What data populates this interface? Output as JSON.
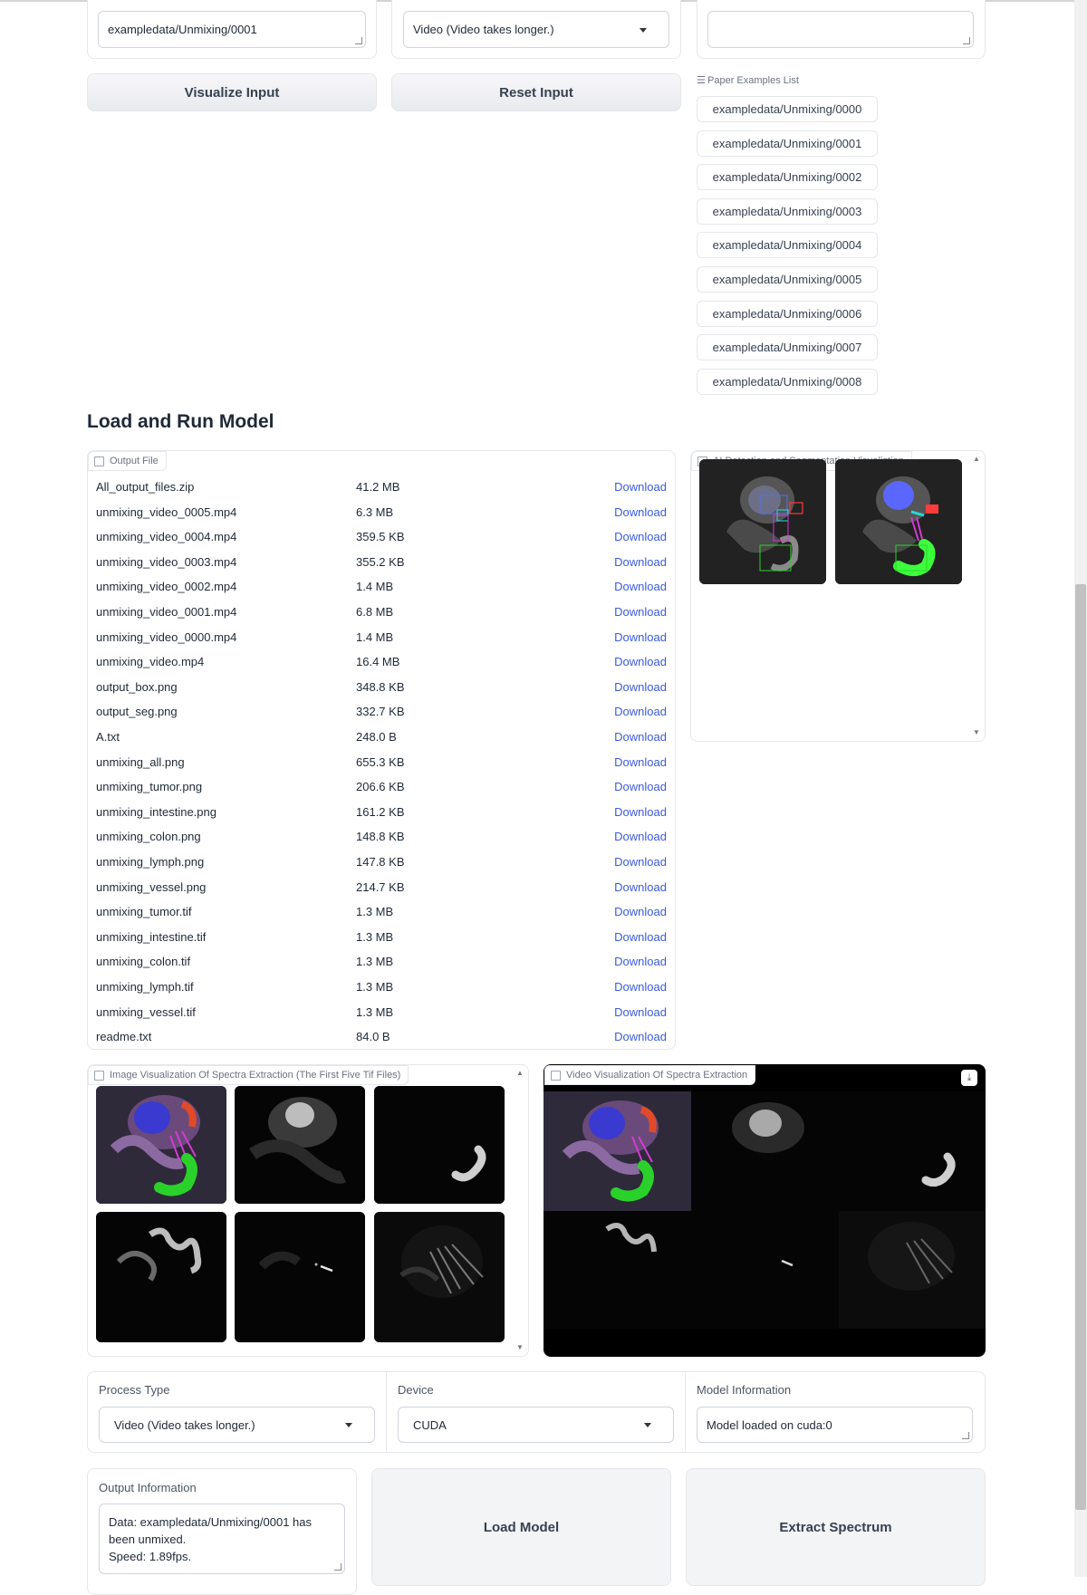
{
  "top_inputs": {
    "data_path_value": "exampledata/Unmixing/0001",
    "process_type_value": "Video (Video takes longer.)",
    "third_value": ""
  },
  "buttons": {
    "visualize": "Visualize Input",
    "reset": "Reset Input",
    "load_model": "Load Model",
    "extract": "Extract Spectrum"
  },
  "examples": {
    "label": "Paper Examples List",
    "items": [
      "exampledata/Unmixing/0000",
      "exampledata/Unmixing/0001",
      "exampledata/Unmixing/0002",
      "exampledata/Unmixing/0003",
      "exampledata/Unmixing/0004",
      "exampledata/Unmixing/0005",
      "exampledata/Unmixing/0006",
      "exampledata/Unmixing/0007",
      "exampledata/Unmixing/0008"
    ]
  },
  "section_title": "Load and Run Model",
  "output_file": {
    "label": "Output File",
    "download_label": "Download",
    "files": [
      {
        "name": "All_output_files.zip",
        "size": "41.2 MB"
      },
      {
        "name": "unmixing_video_0005.mp4",
        "size": "6.3 MB"
      },
      {
        "name": "unmixing_video_0004.mp4",
        "size": "359.5 KB"
      },
      {
        "name": "unmixing_video_0003.mp4",
        "size": "355.2 KB"
      },
      {
        "name": "unmixing_video_0002.mp4",
        "size": "1.4 MB"
      },
      {
        "name": "unmixing_video_0001.mp4",
        "size": "6.8 MB"
      },
      {
        "name": "unmixing_video_0000.mp4",
        "size": "1.4 MB"
      },
      {
        "name": "unmixing_video.mp4",
        "size": "16.4 MB"
      },
      {
        "name": "output_box.png",
        "size": "348.8 KB"
      },
      {
        "name": "output_seg.png",
        "size": "332.7 KB"
      },
      {
        "name": "A.txt",
        "size": "248.0 B"
      },
      {
        "name": "unmixing_all.png",
        "size": "655.3 KB"
      },
      {
        "name": "unmixing_tumor.png",
        "size": "206.6 KB"
      },
      {
        "name": "unmixing_intestine.png",
        "size": "161.2 KB"
      },
      {
        "name": "unmixing_colon.png",
        "size": "148.8 KB"
      },
      {
        "name": "unmixing_lymph.png",
        "size": "147.8 KB"
      },
      {
        "name": "unmixing_vessel.png",
        "size": "214.7 KB"
      },
      {
        "name": "unmixing_tumor.tif",
        "size": "1.3 MB"
      },
      {
        "name": "unmixing_intestine.tif",
        "size": "1.3 MB"
      },
      {
        "name": "unmixing_colon.tif",
        "size": "1.3 MB"
      },
      {
        "name": "unmixing_lymph.tif",
        "size": "1.3 MB"
      },
      {
        "name": "unmixing_vessel.tif",
        "size": "1.3 MB"
      },
      {
        "name": "readme.txt",
        "size": "84.0 B"
      }
    ]
  },
  "ai_viz": {
    "label": "AI Detection and Segmentation Visualiztion"
  },
  "image_viz": {
    "label": "Image Visualization Of Spectra Extraction (The First Five Tif Files)"
  },
  "video_viz": {
    "label": "Video Visualization Of Spectra Extraction"
  },
  "settings": {
    "process_type_label": "Process Type",
    "process_type_value": "Video (Video takes longer.)",
    "device_label": "Device",
    "device_value": "CUDA",
    "model_info_label": "Model Information",
    "model_info_value": "Model loaded on cuda:0"
  },
  "output_info": {
    "label": "Output Information",
    "line1": "Data: exampledata/Unmixing/0001 has",
    "line2": "been unmixed.",
    "line3": "Speed: 1.89fps."
  },
  "colors": {
    "link": "#3b5bdb",
    "button_bg": "#f3f4f6",
    "border": "#e5e7eb"
  }
}
